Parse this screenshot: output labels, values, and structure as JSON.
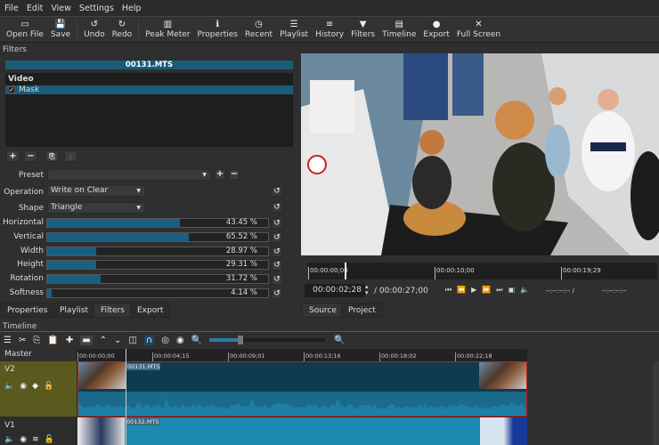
{
  "menu": [
    "File",
    "Edit",
    "View",
    "Settings",
    "Help"
  ],
  "toolbar": [
    {
      "label": "Open File",
      "icon": "folder-icon"
    },
    {
      "label": "Save",
      "icon": "save-icon"
    },
    {
      "label": "Undo",
      "icon": "undo-icon"
    },
    {
      "label": "Redo",
      "icon": "redo-icon"
    },
    {
      "label": "Peak Meter",
      "icon": "meter-icon"
    },
    {
      "label": "Properties",
      "icon": "info-icon"
    },
    {
      "label": "Recent",
      "icon": "clock-icon"
    },
    {
      "label": "Playlist",
      "icon": "list-icon"
    },
    {
      "label": "History",
      "icon": "history-icon"
    },
    {
      "label": "Filters",
      "icon": "filter-icon"
    },
    {
      "label": "Timeline",
      "icon": "timeline-icon"
    },
    {
      "label": "Export",
      "icon": "export-icon"
    },
    {
      "label": "Full Screen",
      "icon": "fullscreen-icon"
    }
  ],
  "filters": {
    "title": "Filters",
    "clip": "00131.MTS",
    "group": "Video",
    "items": [
      {
        "label": "Mask",
        "checked": true
      }
    ],
    "preset_label": "Preset",
    "preset_value": "",
    "operation_label": "Operation",
    "operation_value": "Write on Clear",
    "shape_label": "Shape",
    "shape_value": "Triangle",
    "params": [
      {
        "label": "Horizontal",
        "value": 43.45,
        "text": "43.45 %",
        "fill": 0.6
      },
      {
        "label": "Vertical",
        "value": 65.52,
        "text": "65.52 %",
        "fill": 0.64
      },
      {
        "label": "Width",
        "value": 28.97,
        "text": "28.97 %",
        "fill": 0.22
      },
      {
        "label": "Height",
        "value": 29.31,
        "text": "29.31 %",
        "fill": 0.22
      },
      {
        "label": "Rotation",
        "value": 31.72,
        "text": "31.72 %",
        "fill": 0.24
      },
      {
        "label": "Softness",
        "value": 4.14,
        "text": "4.14 %",
        "fill": 0.02
      }
    ]
  },
  "left_tabs": [
    "Properties",
    "Playlist",
    "Filters",
    "Export"
  ],
  "player": {
    "ruler": [
      "00:00:00;00",
      "00:00:10;00",
      "00:00:19;29"
    ],
    "timecode": "00:00:02;28",
    "duration": "/ 00:00:27;00",
    "in_out": "--:--:--:-- /",
    "out": "--:--:--:--",
    "tabs": [
      "Source",
      "Project"
    ]
  },
  "timeline": {
    "title": "Timeline",
    "master": "Master",
    "ruler": [
      "00:00:00;00",
      "00:00:04;15",
      "00:00:09;01",
      "00:00:13;16",
      "00:00:18;02",
      "00:00:22;18"
    ],
    "zoom_level": 0.27,
    "tracks": [
      {
        "name": "V2",
        "clip": "00131.MTS"
      },
      {
        "name": "V1",
        "clip": "00132.MTS"
      }
    ]
  },
  "colors": {
    "accent": "#1a5b78",
    "v2_header": "#5a5a1e",
    "selected_clip_border": "#c02020"
  }
}
